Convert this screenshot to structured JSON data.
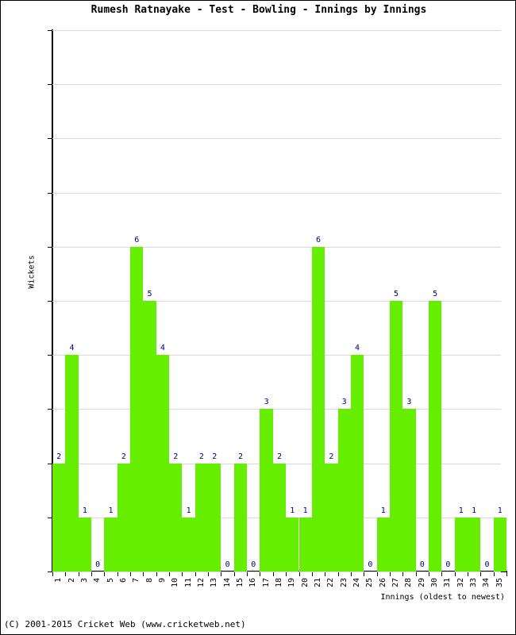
{
  "chart_data": {
    "type": "bar",
    "title": "Rumesh Ratnayake - Test - Bowling - Innings by Innings",
    "xlabel": "Innings (oldest to newest)",
    "ylabel": "Wickets",
    "ylim": [
      0,
      10
    ],
    "yticks": [
      0,
      1,
      2,
      3,
      4,
      5,
      6,
      7,
      8,
      9,
      10
    ],
    "grid": true,
    "legend": null,
    "bar_color": "#66ee00",
    "label_color": "#000080",
    "axis_color": "#000000",
    "gridline_color": "#d9d9d9",
    "categories": [
      "1",
      "2",
      "3",
      "4",
      "5",
      "6",
      "7",
      "8",
      "9",
      "10",
      "11",
      "12",
      "13",
      "14",
      "15",
      "16",
      "17",
      "18",
      "19",
      "20",
      "21",
      "22",
      "23",
      "24",
      "25",
      "26",
      "27",
      "28",
      "29",
      "30",
      "31",
      "32",
      "33",
      "34",
      "35"
    ],
    "values": [
      2,
      4,
      1,
      0,
      1,
      2,
      6,
      5,
      4,
      2,
      1,
      2,
      2,
      0,
      2,
      0,
      3,
      2,
      1,
      1,
      6,
      2,
      3,
      4,
      0,
      1,
      5,
      3,
      0,
      5,
      0,
      1,
      1,
      0,
      1
    ],
    "data_labels": [
      "2",
      "4",
      "1",
      "0",
      "1",
      "2",
      "6",
      "5",
      "4",
      "2",
      "1",
      "2",
      "2",
      "0",
      "2",
      "0",
      "3",
      "2",
      "1",
      "1",
      "6",
      "2",
      "3",
      "4",
      "0",
      "1",
      "5",
      "3",
      "0",
      "5",
      "0",
      "1",
      "1",
      "0",
      "1"
    ]
  },
  "footer": {
    "copyright": "(C) 2001-2015 Cricket Web (www.cricketweb.net)"
  }
}
